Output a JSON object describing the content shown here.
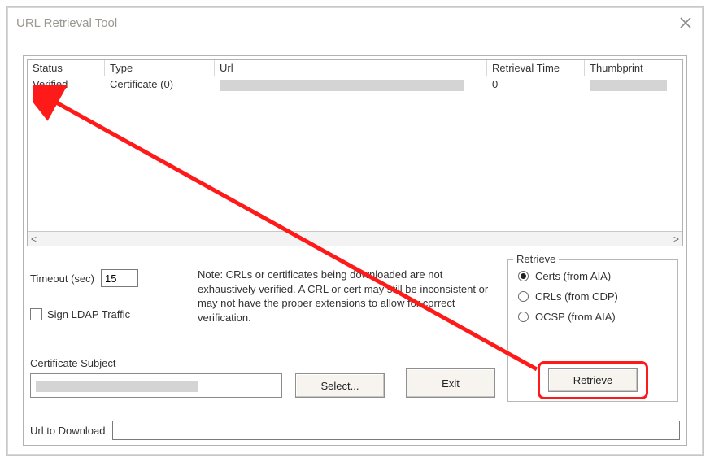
{
  "window": {
    "title": "URL Retrieval Tool"
  },
  "table": {
    "headers": [
      "Status",
      "Type",
      "Url",
      "Retrieval Time",
      "Thumbprint"
    ],
    "rows": [
      {
        "status": "Verified",
        "type": "Certificate (0)",
        "url": "",
        "retrieval_time": "0",
        "thumbprint": ""
      }
    ]
  },
  "timeout": {
    "label": "Timeout (sec)",
    "value": "15"
  },
  "ldap": {
    "label": "Sign LDAP Traffic",
    "checked": false
  },
  "note": "Note: CRLs or certificates being downloaded are not exhaustively verified.  A CRL or cert may still be inconsistent or may not have the proper extensions to allow for correct verification.",
  "retrieve_group": {
    "legend": "Retrieve",
    "options": [
      {
        "label": "Certs (from AIA)",
        "checked": true
      },
      {
        "label": "CRLs (from CDP)",
        "checked": false
      },
      {
        "label": "OCSP (from AIA)",
        "checked": false
      }
    ],
    "button": "Retrieve"
  },
  "cert_subject": {
    "label": "Certificate Subject",
    "value": ""
  },
  "buttons": {
    "select": "Select...",
    "exit": "Exit"
  },
  "url_download": {
    "label": "Url to Download",
    "value": ""
  },
  "colors": {
    "annotation": "#ff1a1a"
  }
}
